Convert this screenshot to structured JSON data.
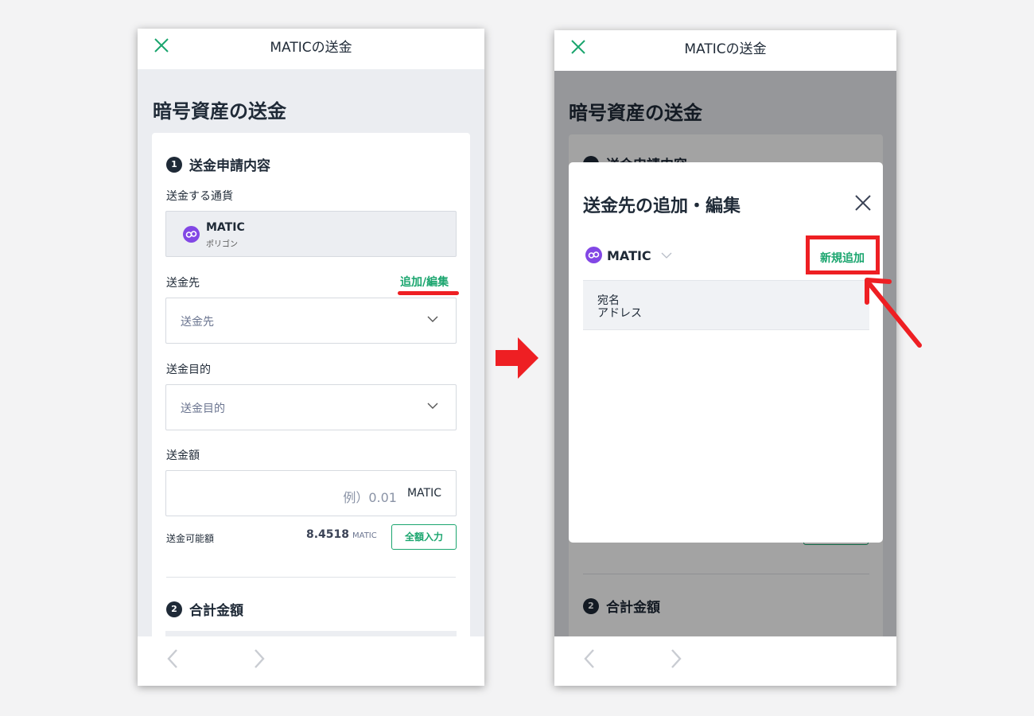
{
  "left": {
    "topbar_title": "MATICの送金",
    "heading": "暗号資産の送金",
    "section1": {
      "number": "1",
      "title": "送金申請内容"
    },
    "currency_label": "送金する通貨",
    "coin": {
      "name": "MATIC",
      "sub": "ポリゴン"
    },
    "dest_label": "送金先",
    "dest_link": "追加/編集",
    "dest_placeholder": "送金先",
    "purpose_label": "送金目的",
    "purpose_placeholder": "送金目的",
    "amount_label": "送金額",
    "amount_placeholder": "例）0.01",
    "amount_unit": "MATIC",
    "available_label": "送金可能額",
    "available_value": "8.4518",
    "available_unit": "MATIC",
    "fill_all_button": "全額入力",
    "section2": {
      "number": "2",
      "title": "合計金額"
    }
  },
  "right": {
    "topbar_title": "MATICの送金",
    "heading": "暗号資産の送金",
    "section1_partial": "送金申請内容",
    "modal": {
      "title": "送金先の追加・編集",
      "coin": "MATIC",
      "new_button": "新規追加",
      "col_name": "宛名",
      "col_address": "アドレス"
    },
    "section2": {
      "number": "2",
      "title": "合計金額"
    }
  },
  "colors": {
    "accent_green": "#1aa56e",
    "highlight_red": "#ee1f23",
    "polygon_purple": "#8247e5",
    "dark_text": "#1f2a37"
  }
}
